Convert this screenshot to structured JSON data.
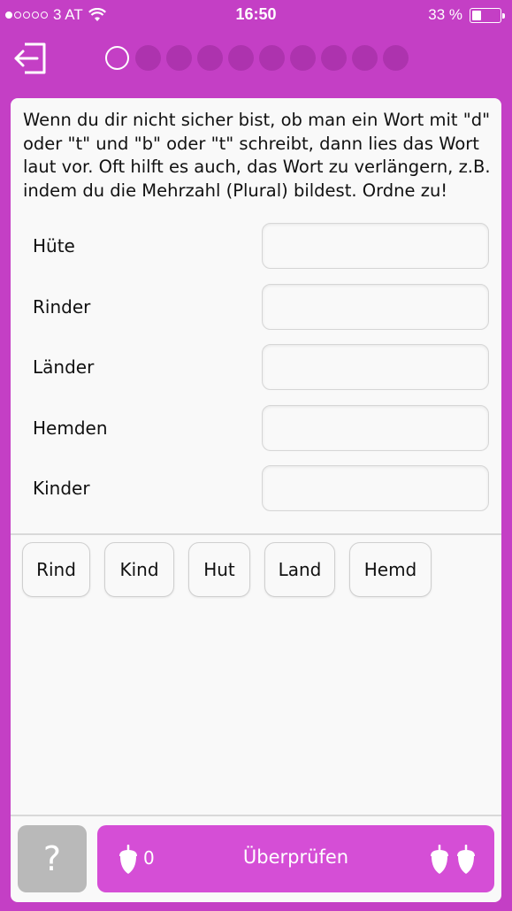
{
  "status_bar": {
    "carrier": "3 AT",
    "time": "16:50",
    "battery": "33 %",
    "battery_level": 0.33,
    "signal_strength": 1
  },
  "progress": {
    "total": 10,
    "current": 1
  },
  "instructions": "Wenn du dir nicht sicher bist, ob man ein Wort mit \"d\" oder \"t\" und \"b\" oder \"t\" schreibt, dann lies das Wort laut vor. Oft hilft es auch, das Wort zu verlängern, z.B. indem du die Mehrzahl (Plural) bildest.  Ordne zu!",
  "rows": [
    {
      "label": "Hüte"
    },
    {
      "label": "Rinder"
    },
    {
      "label": "Länder"
    },
    {
      "label": "Hemden"
    },
    {
      "label": "Kinder"
    }
  ],
  "choices": [
    "Rind",
    "Kind",
    "Hut",
    "Land",
    "Hemd"
  ],
  "footer": {
    "help_label": "?",
    "check_label": "Überprüfen",
    "acorn_count": "0"
  },
  "colors": {
    "background": "#c43fc5",
    "accent_button": "#d54ed6",
    "help_button": "#b9b9b9",
    "card": "#f9f9f9"
  },
  "icons": {
    "exit": "exit-icon",
    "acorn": "acorn-icon"
  }
}
